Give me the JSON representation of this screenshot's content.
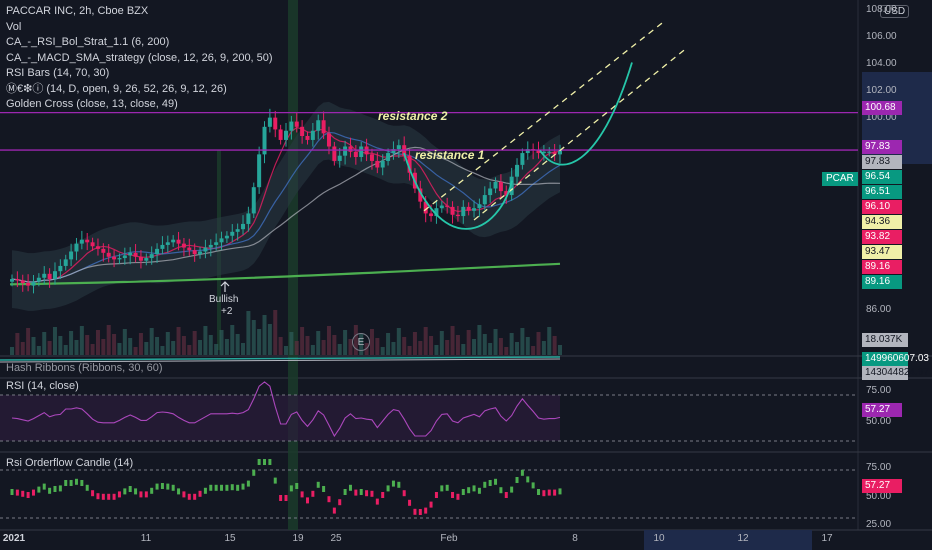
{
  "header": {
    "symbol_line": "PACCAR INC, 2h, Cboe BZX",
    "currency": "USD",
    "indicators": [
      "Vol",
      "CA_-_RSI_Bol_Strat_1.1 (6, 200)",
      "CA_-_MACD_SMA_strategy (close, 12, 26, 9, 200, 50)",
      "RSI Bars (14, 70, 30)",
      "Ⓜ€❇ⓘ (14, D, open, 9, 26, 52, 26, 9, 12, 26)",
      "Golden Cross (close, 13, close, 49)"
    ]
  },
  "annotations": {
    "resistance2": "resistance 2",
    "resistance1": "resistance 1",
    "bullish": "Bullish",
    "bullish_value": "+2",
    "earnings_marker": "E"
  },
  "price_axis": {
    "ticks": [
      "108.00",
      "106.00",
      "104.00",
      "102.00",
      "100.00",
      "86.00"
    ]
  },
  "price_tags": [
    {
      "value": "100.68",
      "bg": "#9c27b0",
      "fg": "#ffffff"
    },
    {
      "value": "97.83",
      "bg": "#9c27b0",
      "fg": "#ffffff"
    },
    {
      "value": "97.83",
      "bg": "#b2b5be",
      "fg": "#131722"
    },
    {
      "value": "96.54",
      "bg": "#089981",
      "fg": "#ffffff"
    },
    {
      "value": "96.51",
      "bg": "#089981",
      "fg": "#ffffff"
    },
    {
      "value": "96.10",
      "bg": "#e91e63",
      "fg": "#ffffff"
    },
    {
      "value": "94.36",
      "bg": "#f0f0a8",
      "fg": "#131722"
    },
    {
      "value": "93.82",
      "bg": "#e91e63",
      "fg": "#ffffff"
    },
    {
      "value": "93.47",
      "bg": "#f0f0a8",
      "fg": "#131722"
    },
    {
      "value": "89.16",
      "bg": "#e91e63",
      "fg": "#ffffff"
    },
    {
      "value": "89.16",
      "bg": "#089981",
      "fg": "#ffffff"
    },
    {
      "value": "18.037K",
      "bg": "#b2b5be",
      "fg": "#131722"
    }
  ],
  "symbol_tag": "PCAR",
  "hash_ribbons": {
    "title": "Hash Ribbons (Ribbons, 30, 60)",
    "tags": [
      "149960607.03",
      "143044824.97"
    ]
  },
  "rsi": {
    "title": "RSI (14, close)",
    "ticks": [
      "75.00",
      "50.00"
    ],
    "tag": "57.27"
  },
  "rsi_orderflow": {
    "title": "Rsi Orderflow Candle (14)",
    "ticks": [
      "75.00",
      "50.00",
      "25.00"
    ],
    "tag": "57.27"
  },
  "time_axis": {
    "labels": [
      "2021",
      "11",
      "15",
      "19",
      "25",
      "Feb",
      "8",
      "10",
      "12",
      "17"
    ]
  },
  "chart_data": {
    "type": "candlestick",
    "title": "PACCAR INC, 2h, Cboe BZX",
    "ylim": [
      84.5,
      108.5
    ],
    "horizontal_levels": [
      100.68,
      97.83
    ],
    "last_price": 97.83,
    "close_path": [
      88.0,
      87.9,
      87.7,
      87.5,
      87.8,
      88.1,
      88.4,
      88.0,
      88.6,
      89.0,
      89.5,
      90.1,
      90.7,
      91.0,
      90.8,
      90.5,
      90.3,
      90.0,
      89.7,
      89.5,
      89.6,
      89.8,
      90.0,
      89.7,
      89.4,
      89.6,
      89.9,
      90.3,
      90.6,
      90.8,
      91.0,
      90.7,
      90.4,
      90.2,
      89.9,
      90.1,
      90.4,
      90.6,
      90.8,
      91.1,
      91.3,
      91.6,
      91.8,
      92.2,
      93.0,
      95.0,
      97.5,
      99.6,
      100.3,
      99.4,
      98.6,
      99.3,
      100.0,
      99.6,
      98.9,
      98.6,
      99.3,
      100.1,
      99.1,
      98.1,
      97.0,
      97.4,
      98.1,
      97.7,
      97.3,
      98.1,
      97.5,
      97.0,
      96.5,
      97.0,
      97.6,
      97.9,
      98.2,
      97.4,
      96.1,
      94.9,
      93.9,
      93.0,
      92.8,
      93.4,
      93.6,
      93.5,
      92.9,
      92.8,
      93.5,
      93.2,
      93.4,
      93.7,
      94.4,
      94.9,
      95.4,
      94.7,
      94.4,
      95.8,
      96.7,
      97.6,
      97.9,
      97.8,
      97.6,
      97.7,
      97.7,
      97.5,
      97.8
    ]
  }
}
